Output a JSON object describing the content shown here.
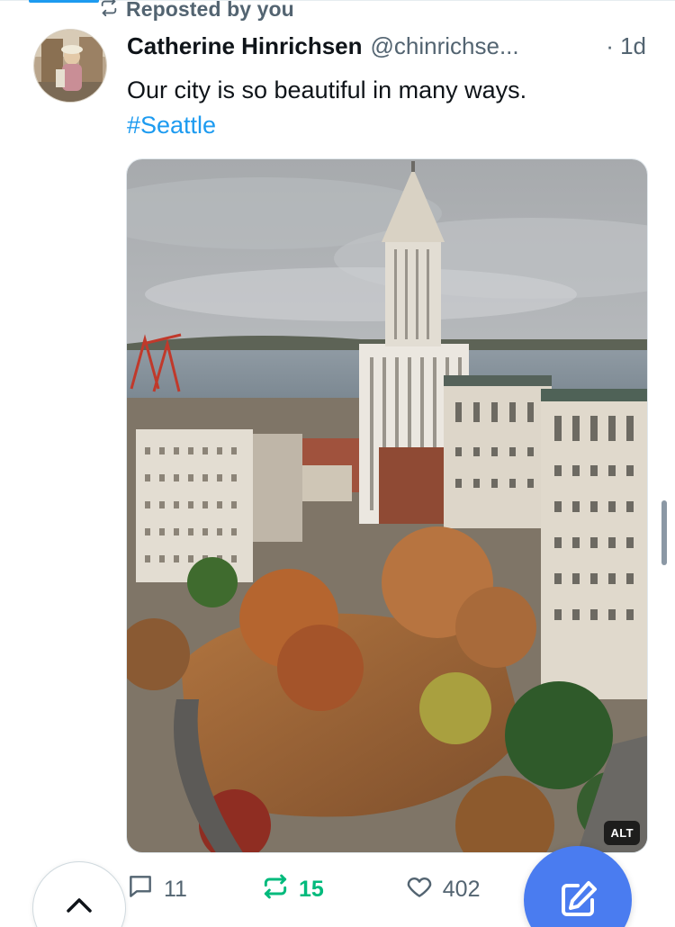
{
  "repost_banner": {
    "label": "Reposted by you",
    "icon": "repost-icon"
  },
  "post": {
    "author": {
      "display_name": "Catherine Hinrichsen",
      "handle": "@chinrichse...",
      "avatar": "avatar-photo"
    },
    "timestamp": "· 1d",
    "text": "Our city is so beautiful in many ways.",
    "hashtag": "#Seattle",
    "media": {
      "alt_badge": "ALT"
    },
    "actions": {
      "replies": "11",
      "reposts": "15",
      "likes": "402"
    }
  },
  "colors": {
    "link": "#1d9bf0",
    "repost_active": "#00ba7c",
    "muted": "#536471",
    "fab": "#4a7cf0"
  },
  "icons": {
    "reply": "reply-icon",
    "repost": "repost-icon",
    "like": "heart-icon",
    "scroll_top": "chevron-up-icon",
    "compose": "compose-icon"
  }
}
